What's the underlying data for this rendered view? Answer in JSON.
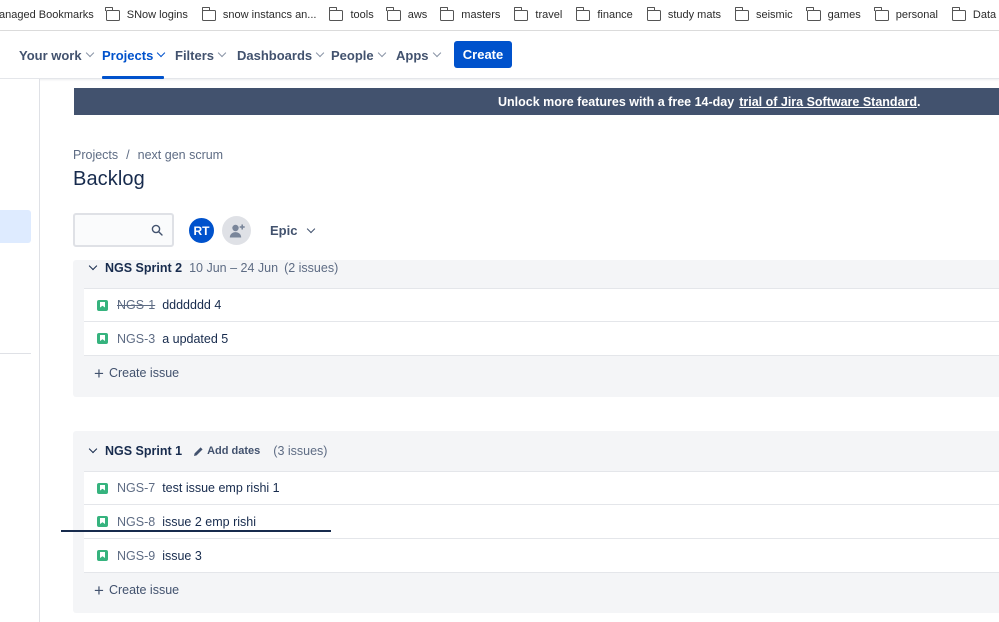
{
  "bookmarks": [
    {
      "label": "anaged Bookmarks",
      "icon": "none"
    },
    {
      "label": "SNow logins",
      "icon": "folder-icon"
    },
    {
      "label": "snow instancs an...",
      "icon": "folder-icon"
    },
    {
      "label": "tools",
      "icon": "folder-icon"
    },
    {
      "label": "aws",
      "icon": "folder-icon"
    },
    {
      "label": "masters",
      "icon": "folder-icon"
    },
    {
      "label": "travel",
      "icon": "folder-icon"
    },
    {
      "label": "finance",
      "icon": "folder-icon"
    },
    {
      "label": "study mats",
      "icon": "folder-icon"
    },
    {
      "label": "seismic",
      "icon": "folder-icon"
    },
    {
      "label": "games",
      "icon": "folder-icon"
    },
    {
      "label": "personal",
      "icon": "folder-icon"
    },
    {
      "label": "Data scien",
      "icon": "folder-icon"
    }
  ],
  "nav": {
    "items": [
      {
        "label": "Your work",
        "active": false
      },
      {
        "label": "Projects",
        "active": true
      },
      {
        "label": "Filters",
        "active": false
      },
      {
        "label": "Dashboards",
        "active": false
      },
      {
        "label": "People",
        "active": false
      },
      {
        "label": "Apps",
        "active": false
      }
    ],
    "create_label": "Create",
    "accent_color": "#0052CC"
  },
  "banner": {
    "text": "Unlock more features with a free 14-day",
    "link": "trial of Jira Software Standard",
    "suffix": ".",
    "background": "#42526E"
  },
  "breadcrumb": {
    "items": [
      "Projects",
      "next gen scrum"
    ],
    "separator": "/"
  },
  "page_title": "Backlog",
  "filters": {
    "search_placeholder": "",
    "avatar_initials": "RT",
    "epic_label": "Epic"
  },
  "sprints": [
    {
      "name": "NGS Sprint 2",
      "dates": "10 Jun – 24 Jun",
      "count": "(2 issues)",
      "issues": [
        {
          "key": "NGS-1",
          "summary": "ddddddd 4",
          "done": true
        },
        {
          "key": "NGS-3",
          "summary": "a updated 5",
          "done": false
        }
      ],
      "create_label": "Create issue"
    },
    {
      "name": "NGS Sprint 1",
      "add_dates_label": "Add dates",
      "count": "(3 issues)",
      "issues": [
        {
          "key": "NGS-7",
          "summary": "test issue emp rishi 1",
          "done": false
        },
        {
          "key": "NGS-8",
          "summary": "issue 2 emp rishi",
          "done": false
        },
        {
          "key": "NGS-9",
          "summary": "issue 3",
          "done": false
        }
      ],
      "create_label": "Create issue"
    }
  ]
}
